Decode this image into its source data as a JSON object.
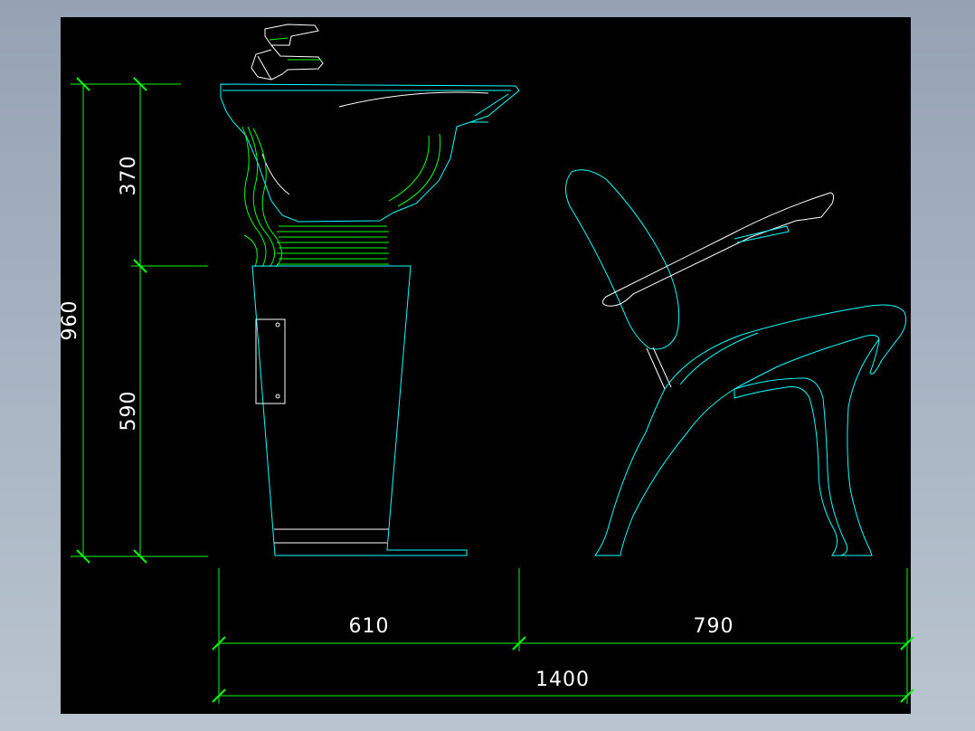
{
  "dimensions": {
    "height_total": "960",
    "height_basin": "370",
    "height_pedestal": "590",
    "width_basin": "610",
    "width_chair": "790",
    "width_total": "1400"
  },
  "colors": {
    "background": "#000000",
    "dimension_lines": "#00ff00",
    "outline_cyan": "#00ffff",
    "outline_white": "#ffffff",
    "hose_green": "#00ff00"
  }
}
